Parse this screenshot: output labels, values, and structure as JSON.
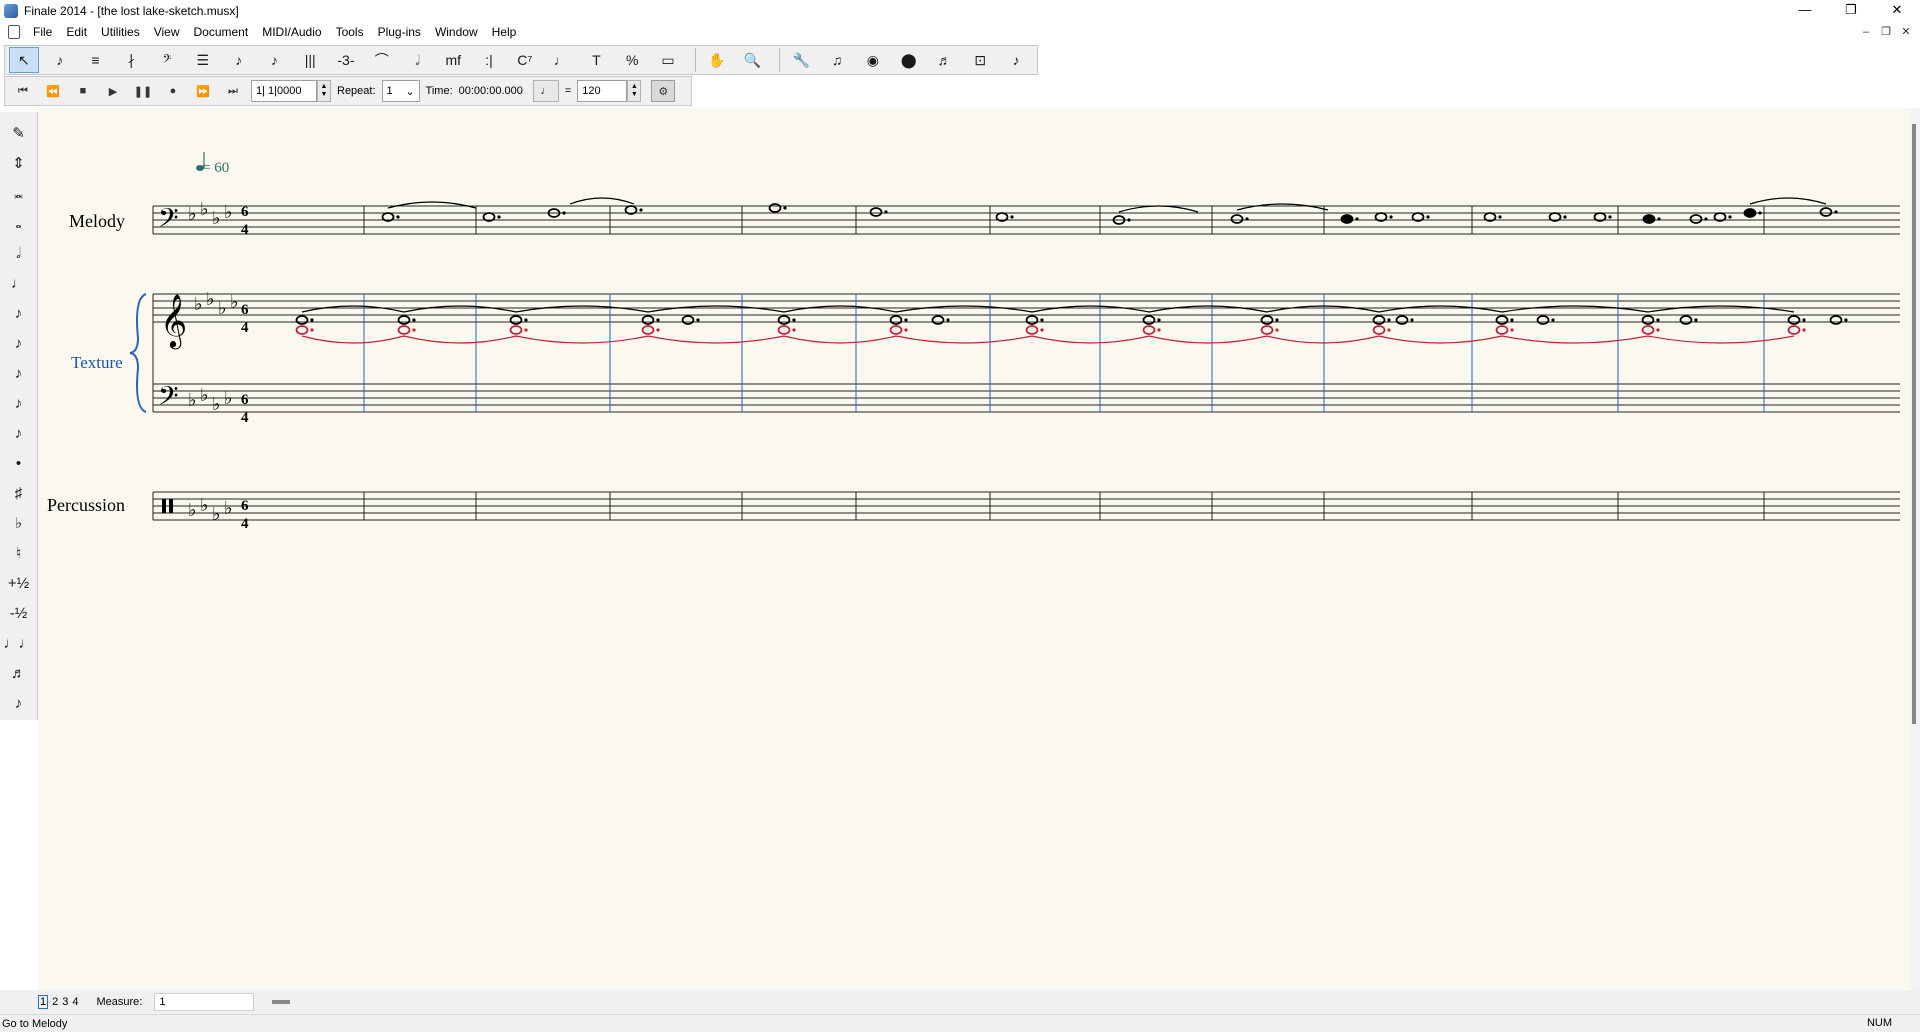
{
  "window": {
    "title": "Finale 2014 - [the lost lake-sketch.musx]",
    "minimize": "—",
    "maximize": "❐",
    "close": "✕"
  },
  "menu": [
    "File",
    "Edit",
    "Utilities",
    "View",
    "Document",
    "MIDI/Audio",
    "Tools",
    "Plug-ins",
    "Window",
    "Help"
  ],
  "mdi": {
    "minimize": "–",
    "restore": "❐",
    "close": "✕"
  },
  "toolbar": {
    "tools": [
      {
        "name": "selection-tool",
        "glyph": "↖"
      },
      {
        "name": "simple-entry-tool",
        "glyph": "♪"
      },
      {
        "name": "speedy-entry-tool",
        "glyph": "≡"
      },
      {
        "name": "hyperscribe-tool",
        "glyph": "∤"
      },
      {
        "name": "clef-tool",
        "glyph": "𝄢"
      },
      {
        "name": "staff-tool",
        "glyph": "☰"
      },
      {
        "name": "note-tool",
        "glyph": "♪"
      },
      {
        "name": "smart-note-tool",
        "glyph": "♪"
      },
      {
        "name": "measure-tool",
        "glyph": "|||"
      },
      {
        "name": "tuplet-tool",
        "glyph": "-3-"
      },
      {
        "name": "smart-shape-tool",
        "glyph": "⌒"
      },
      {
        "name": "articulation-tool",
        "glyph": "𝅗𝅥"
      },
      {
        "name": "expression-tool",
        "glyph": "mf"
      },
      {
        "name": "repeat-tool",
        "glyph": ":|"
      },
      {
        "name": "chord-tool",
        "glyph": "C⁷"
      },
      {
        "name": "lyric-tool",
        "glyph": "♩"
      },
      {
        "name": "text-tool",
        "glyph": "T"
      },
      {
        "name": "resize-tool",
        "glyph": "%"
      },
      {
        "name": "page-layout-tool",
        "glyph": "▭"
      },
      {
        "name": "hand-grabber-tool",
        "glyph": "✋"
      },
      {
        "name": "zoom-tool",
        "glyph": "🔍"
      },
      {
        "name": "special-tools",
        "glyph": "🔧"
      },
      {
        "name": "midi-tool",
        "glyph": "♫"
      },
      {
        "name": "playback-midi-tool",
        "glyph": "◉"
      },
      {
        "name": "human-playback-tool",
        "glyph": "⬤"
      },
      {
        "name": "graphics-tool",
        "glyph": "♬"
      },
      {
        "name": "ossia-tool",
        "glyph": "⊡"
      },
      {
        "name": "mirror-tool",
        "glyph": "♪"
      }
    ]
  },
  "playback": {
    "buttons": [
      "⏮",
      "⏪",
      "■",
      "▶",
      "❚❚",
      "●",
      "⏩",
      "⏭"
    ],
    "position": "1| 1|0000",
    "repeat_label": "Repeat:",
    "repeat_value": "1",
    "time_label": "Time:",
    "time_value": "00:00:00.000",
    "eq": "=",
    "tempo": "120"
  },
  "palette": [
    "✎",
    "⇕",
    "𝅜",
    "𝅝",
    "𝅗𝅥",
    "♩",
    "♪",
    "♪",
    "♪",
    "♪",
    "♪",
    "•",
    "♯",
    "♭",
    "♮",
    "+½",
    "-½",
    "♩♩",
    "♬",
    "♪"
  ],
  "score": {
    "tempo_marking": "= 60",
    "staves": [
      "Melody",
      "Texture",
      "Percussion"
    ],
    "time_sig": {
      "top": "6",
      "bottom": "4"
    },
    "colors": {
      "paper": "#fbf9ef",
      "accent": "#1a56a8",
      "red_notes": "#c0233b",
      "tempo": "#2e6e6a"
    }
  },
  "pagebar": {
    "pages": [
      "1",
      "2",
      "3",
      "4"
    ],
    "measure_label": "Measure:",
    "measure_value": "1"
  },
  "status": {
    "text": "Go to Melody",
    "num": "NUM"
  }
}
